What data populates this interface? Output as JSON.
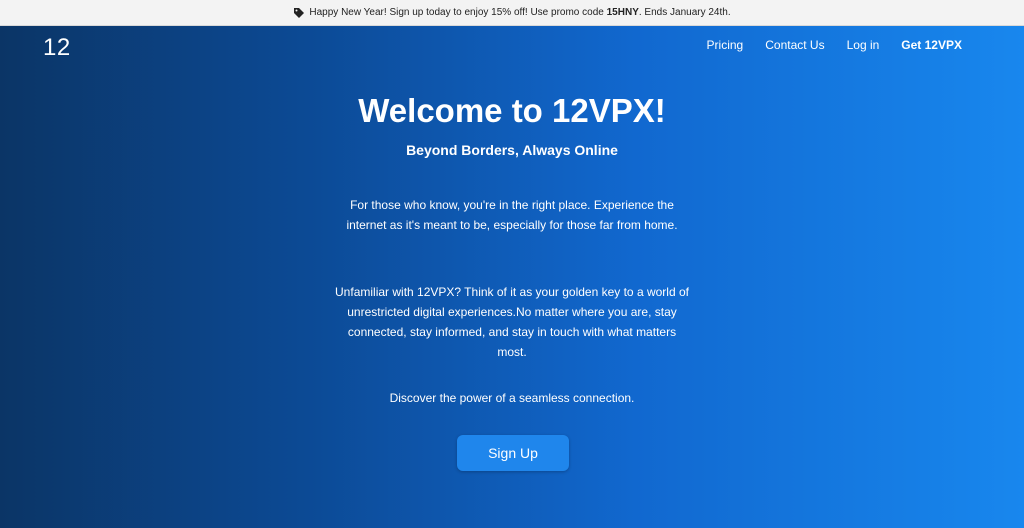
{
  "banner": {
    "icon": "tag-icon",
    "text_before": "Happy New Year! Sign up today to enjoy 15% off! Use promo code ",
    "promo_code": "15HNY",
    "text_after": ". Ends January 24th."
  },
  "header": {
    "logo": "12",
    "nav": [
      "Pricing",
      "Contact Us",
      "Log in",
      "Get 12VPX"
    ]
  },
  "hero": {
    "title": "Welcome to 12VPX!",
    "subtitle": "Beyond Borders, Always Online",
    "paragraph1": "For those who know, you're in the right place. Experience the internet as it's meant to be, especially for those far from home.",
    "paragraph2": "Unfamiliar with 12VPX? Think of it as your golden key to a world of unrestricted digital experiences.No matter where you are, stay connected, stay informed, and stay in touch with what matters most.",
    "paragraph3": "Discover the power of a seamless connection.",
    "signup_label": "Sign Up"
  },
  "colors": {
    "gradient_start": "#0b3566",
    "gradient_end": "#1887ee",
    "button": "#1f86ec",
    "banner_bg": "#f3f3f3"
  }
}
